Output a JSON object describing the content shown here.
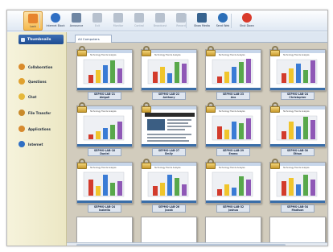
{
  "toolbar": {
    "buttons": [
      {
        "label": "Lock",
        "icon": "lock-icon",
        "color": "#e7842e",
        "active": true,
        "dim": false
      },
      {
        "label": "Internet Block",
        "icon": "globe-icon",
        "color": "#2f6fc4",
        "active": false,
        "dim": false
      },
      {
        "label": "Announce",
        "icon": "megaphone-icon",
        "color": "#6f86a3",
        "active": false,
        "dim": false
      },
      {
        "label": "Exit",
        "icon": "exit-icon",
        "color": "#b7c1ce",
        "active": false,
        "dim": true
      },
      {
        "label": "Monitor",
        "icon": "monitor-icon",
        "color": "#b7c1ce",
        "active": false,
        "dim": true
      },
      {
        "label": "Control",
        "icon": "control-icon",
        "color": "#b7c1ce",
        "active": false,
        "dim": true
      },
      {
        "label": "Broadcast",
        "icon": "broadcast-icon",
        "color": "#b7c1ce",
        "active": false,
        "dim": true
      },
      {
        "label": "Record",
        "icon": "record-icon",
        "color": "#b7c1ce",
        "active": false,
        "dim": true
      },
      {
        "label": "Show Media",
        "icon": "media-icon",
        "color": "#37638f",
        "active": false,
        "dim": false
      },
      {
        "label": "Send Web",
        "icon": "web-icon",
        "color": "#2c6fb8",
        "active": false,
        "dim": false
      },
      {
        "label": "Shut Down",
        "icon": "power-icon",
        "color": "#d93a2b",
        "active": false,
        "dim": false
      }
    ]
  },
  "sidebar": {
    "thumbnails_label": "Thumbnails",
    "items": [
      {
        "label": "Collaboration",
        "icon": "collaboration-icon",
        "color": "#d98b2b"
      },
      {
        "label": "Questions",
        "icon": "questions-icon",
        "color": "#e0a12f"
      },
      {
        "label": "Chat",
        "icon": "chat-icon",
        "color": "#e5b83a"
      },
      {
        "label": "File Transfer",
        "icon": "file-transfer-icon",
        "color": "#c98a2b"
      },
      {
        "label": "Applications",
        "icon": "applications-icon",
        "color": "#d78a2e"
      },
      {
        "label": "Internet",
        "icon": "internet-icon",
        "color": "#2f6fc4"
      }
    ]
  },
  "tabs": {
    "active_label": "All Computers"
  },
  "computers": [
    {
      "id": "SEPMS-LAB-21",
      "name": "Abigail",
      "screen": "chart"
    },
    {
      "id": "SEPMS-LAB-22",
      "name": "Anthony",
      "screen": "chart"
    },
    {
      "id": "SEPMS-LAB-23",
      "name": "Ava",
      "screen": "chart"
    },
    {
      "id": "SEPMS-LAB-24",
      "name": "Christopher",
      "screen": "chart"
    },
    {
      "id": "SEPMS-LAB-18",
      "name": "Daniel",
      "screen": "chart"
    },
    {
      "id": "SEPMS-LAB-27",
      "name": "Emily",
      "screen": "web"
    },
    {
      "id": "SEPMS-LAB-29",
      "name": "Emma",
      "screen": "chart"
    },
    {
      "id": "SEPMS-LAB-30",
      "name": "Ethan",
      "screen": "chart"
    },
    {
      "id": "SEPMS-LAB-24",
      "name": "Isabella",
      "screen": "chart"
    },
    {
      "id": "SEPMS-LAB-26",
      "name": "Jacob",
      "screen": "chart"
    },
    {
      "id": "SEPMS-LAB-32",
      "name": "Joshua",
      "screen": "chart"
    },
    {
      "id": "SEPMS-LAB-34",
      "name": "Madison",
      "screen": "chart"
    }
  ],
  "screen_caption": "Technology Trends Analysis",
  "bar_colors": [
    "#d33b2c",
    "#f0c52c",
    "#3a7bd5",
    "#58a84b",
    "#8f58b6"
  ]
}
